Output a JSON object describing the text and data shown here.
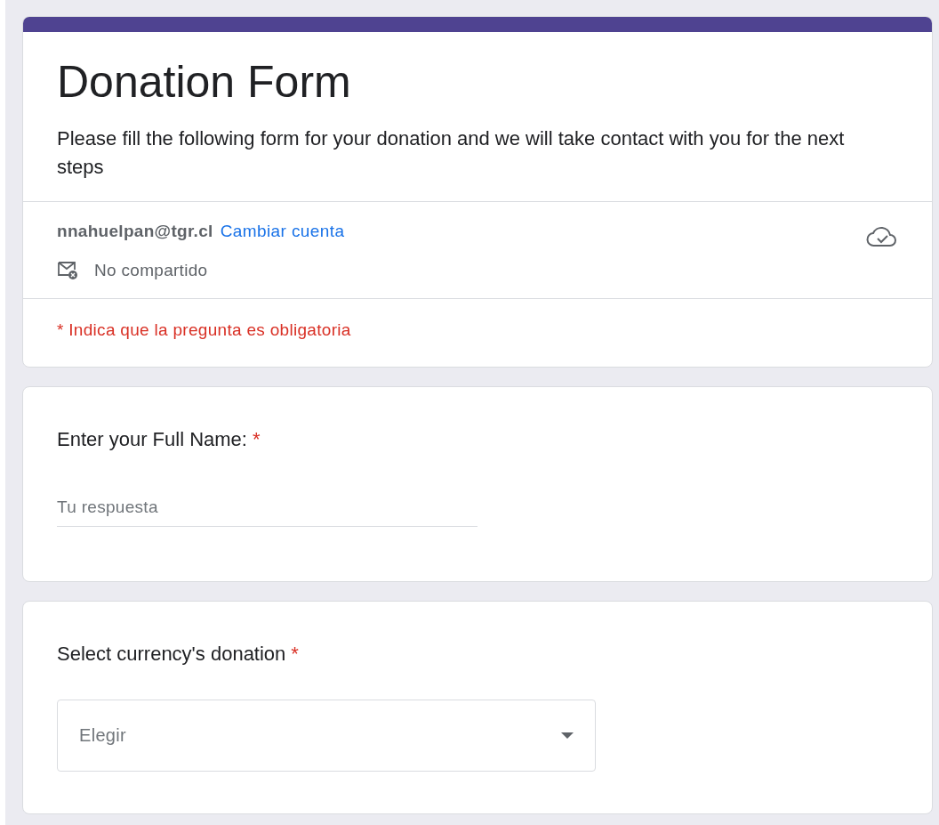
{
  "form": {
    "title": "Donation Form",
    "description": "Please fill the following form for your donation and we will take contact with you for the next steps"
  },
  "account": {
    "email": "nnahuelpan@tgr.cl",
    "switch_link": "Cambiar cuenta",
    "sharing": "No compartido"
  },
  "required_note": "* Indica que la pregunta es obligatoria",
  "questions": [
    {
      "kind": "text",
      "label": "Enter your Full Name:",
      "required": true,
      "required_mark": "*",
      "placeholder": "Tu respuesta"
    },
    {
      "kind": "select",
      "label": "Select currency's donation",
      "required": true,
      "required_mark": "*",
      "placeholder": "Elegir"
    }
  ]
}
